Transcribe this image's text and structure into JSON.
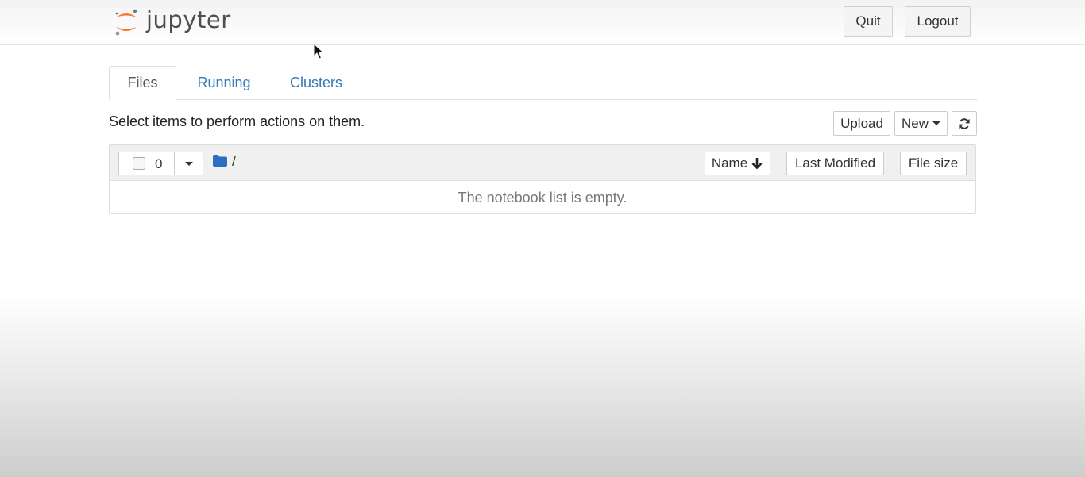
{
  "header": {
    "logo_text": "jupyter",
    "quit_label": "Quit",
    "logout_label": "Logout"
  },
  "tabs": [
    {
      "label": "Files",
      "active": true
    },
    {
      "label": "Running",
      "active": false
    },
    {
      "label": "Clusters",
      "active": false
    }
  ],
  "toolbar": {
    "hint": "Select items to perform actions on them.",
    "upload_label": "Upload",
    "new_label": "New",
    "refresh_icon": "refresh-icon"
  },
  "file_list": {
    "selected_count": "0",
    "path": "/",
    "columns": {
      "name": "Name",
      "last_modified": "Last Modified",
      "file_size": "File size"
    },
    "empty_message": "The notebook list is empty."
  },
  "colors": {
    "link": "#337ab7",
    "folder": "#2a6fc0",
    "logo_orange": "#f37726"
  }
}
